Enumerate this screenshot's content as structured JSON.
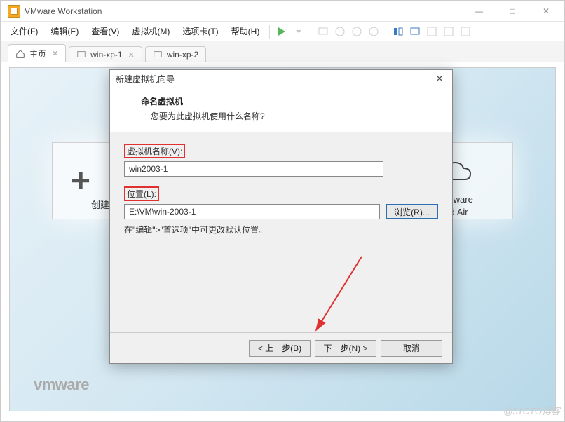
{
  "title": "VMware Workstation",
  "menu": {
    "file": "文件(F)",
    "edit": "编辑(E)",
    "view": "查看(V)",
    "vm": "虚拟机(M)",
    "tabs": "选项卡(T)",
    "help": "帮助(H)"
  },
  "tabs": {
    "home": "主页",
    "t1": "win-xp-1",
    "t2": "win-xp-2"
  },
  "card": {
    "create": "创建新的",
    "cloud1": "VMware",
    "cloud2": "ud Air"
  },
  "logo": "vmware",
  "watermark": "@51CTO博客",
  "dialog": {
    "title": "新建虚拟机向导",
    "heading": "命名虚拟机",
    "sub": "您要为此虚拟机使用什么名称?",
    "name_label": "虚拟机名称(V):",
    "name_value": "win2003-1",
    "loc_label": "位置(L):",
    "loc_value": "E:\\VM\\win-2003-1",
    "browse": "浏览(R)...",
    "note": "在\"编辑\">\"首选项\"中可更改默认位置。",
    "back": "< 上一步(B)",
    "next": "下一步(N) >",
    "cancel": "取消"
  }
}
